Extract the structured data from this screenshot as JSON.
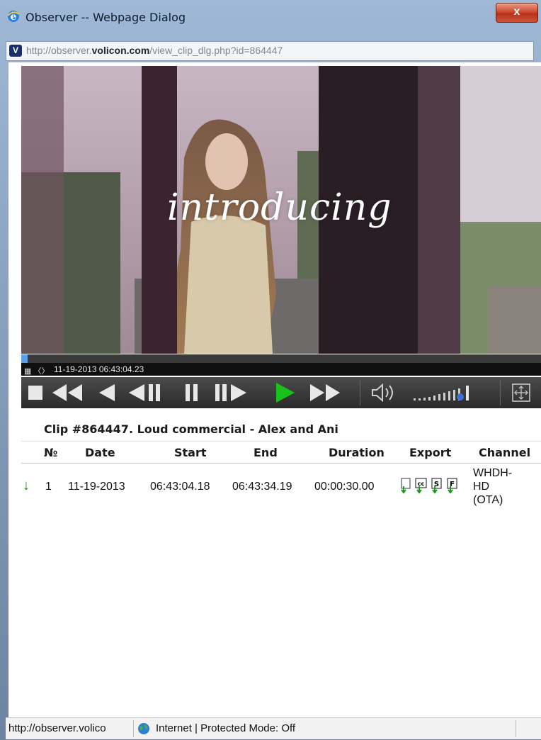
{
  "window": {
    "title": "Observer -- Webpage Dialog",
    "close_label": "x",
    "address_prefix": "http://observer.",
    "address_domain": "volicon.com",
    "address_path": "/view_clip_dlg.php?id=864447"
  },
  "video": {
    "overlay_text": "introducing",
    "timestamp": "11-19-2013 06:43:04.23",
    "progress": 0.012
  },
  "controls": {
    "icons": [
      "stop-icon",
      "fast-rewind-icon",
      "rewind-icon",
      "step-back-icon",
      "pause-icon",
      "step-forward-icon",
      "play-icon",
      "fast-forward-icon",
      "volume-icon",
      "volume-level-icon",
      "fullscreen-icon"
    ],
    "play_color": "#19c219"
  },
  "clip": {
    "title": "Clip #864447. Loud commercial - Alex and Ani",
    "columns": [
      "№",
      "Date",
      "Start",
      "End",
      "Duration",
      "Export",
      "Channel"
    ],
    "rows": [
      {
        "num": "1",
        "date": "11-19-2013",
        "start": "06:43:04.18",
        "end": "06:43:34.19",
        "duration": "00:00:30.00",
        "channel_line1": "WHDH-",
        "channel_line2": "HD",
        "channel_line3": "(OTA)",
        "export_icons": [
          "export-video-icon",
          "export-cc-icon",
          "export-s-icon",
          "export-f-icon"
        ]
      }
    ]
  },
  "statusbar": {
    "url": "http://observer.volico",
    "zone": "Internet | Protected Mode: Off"
  }
}
